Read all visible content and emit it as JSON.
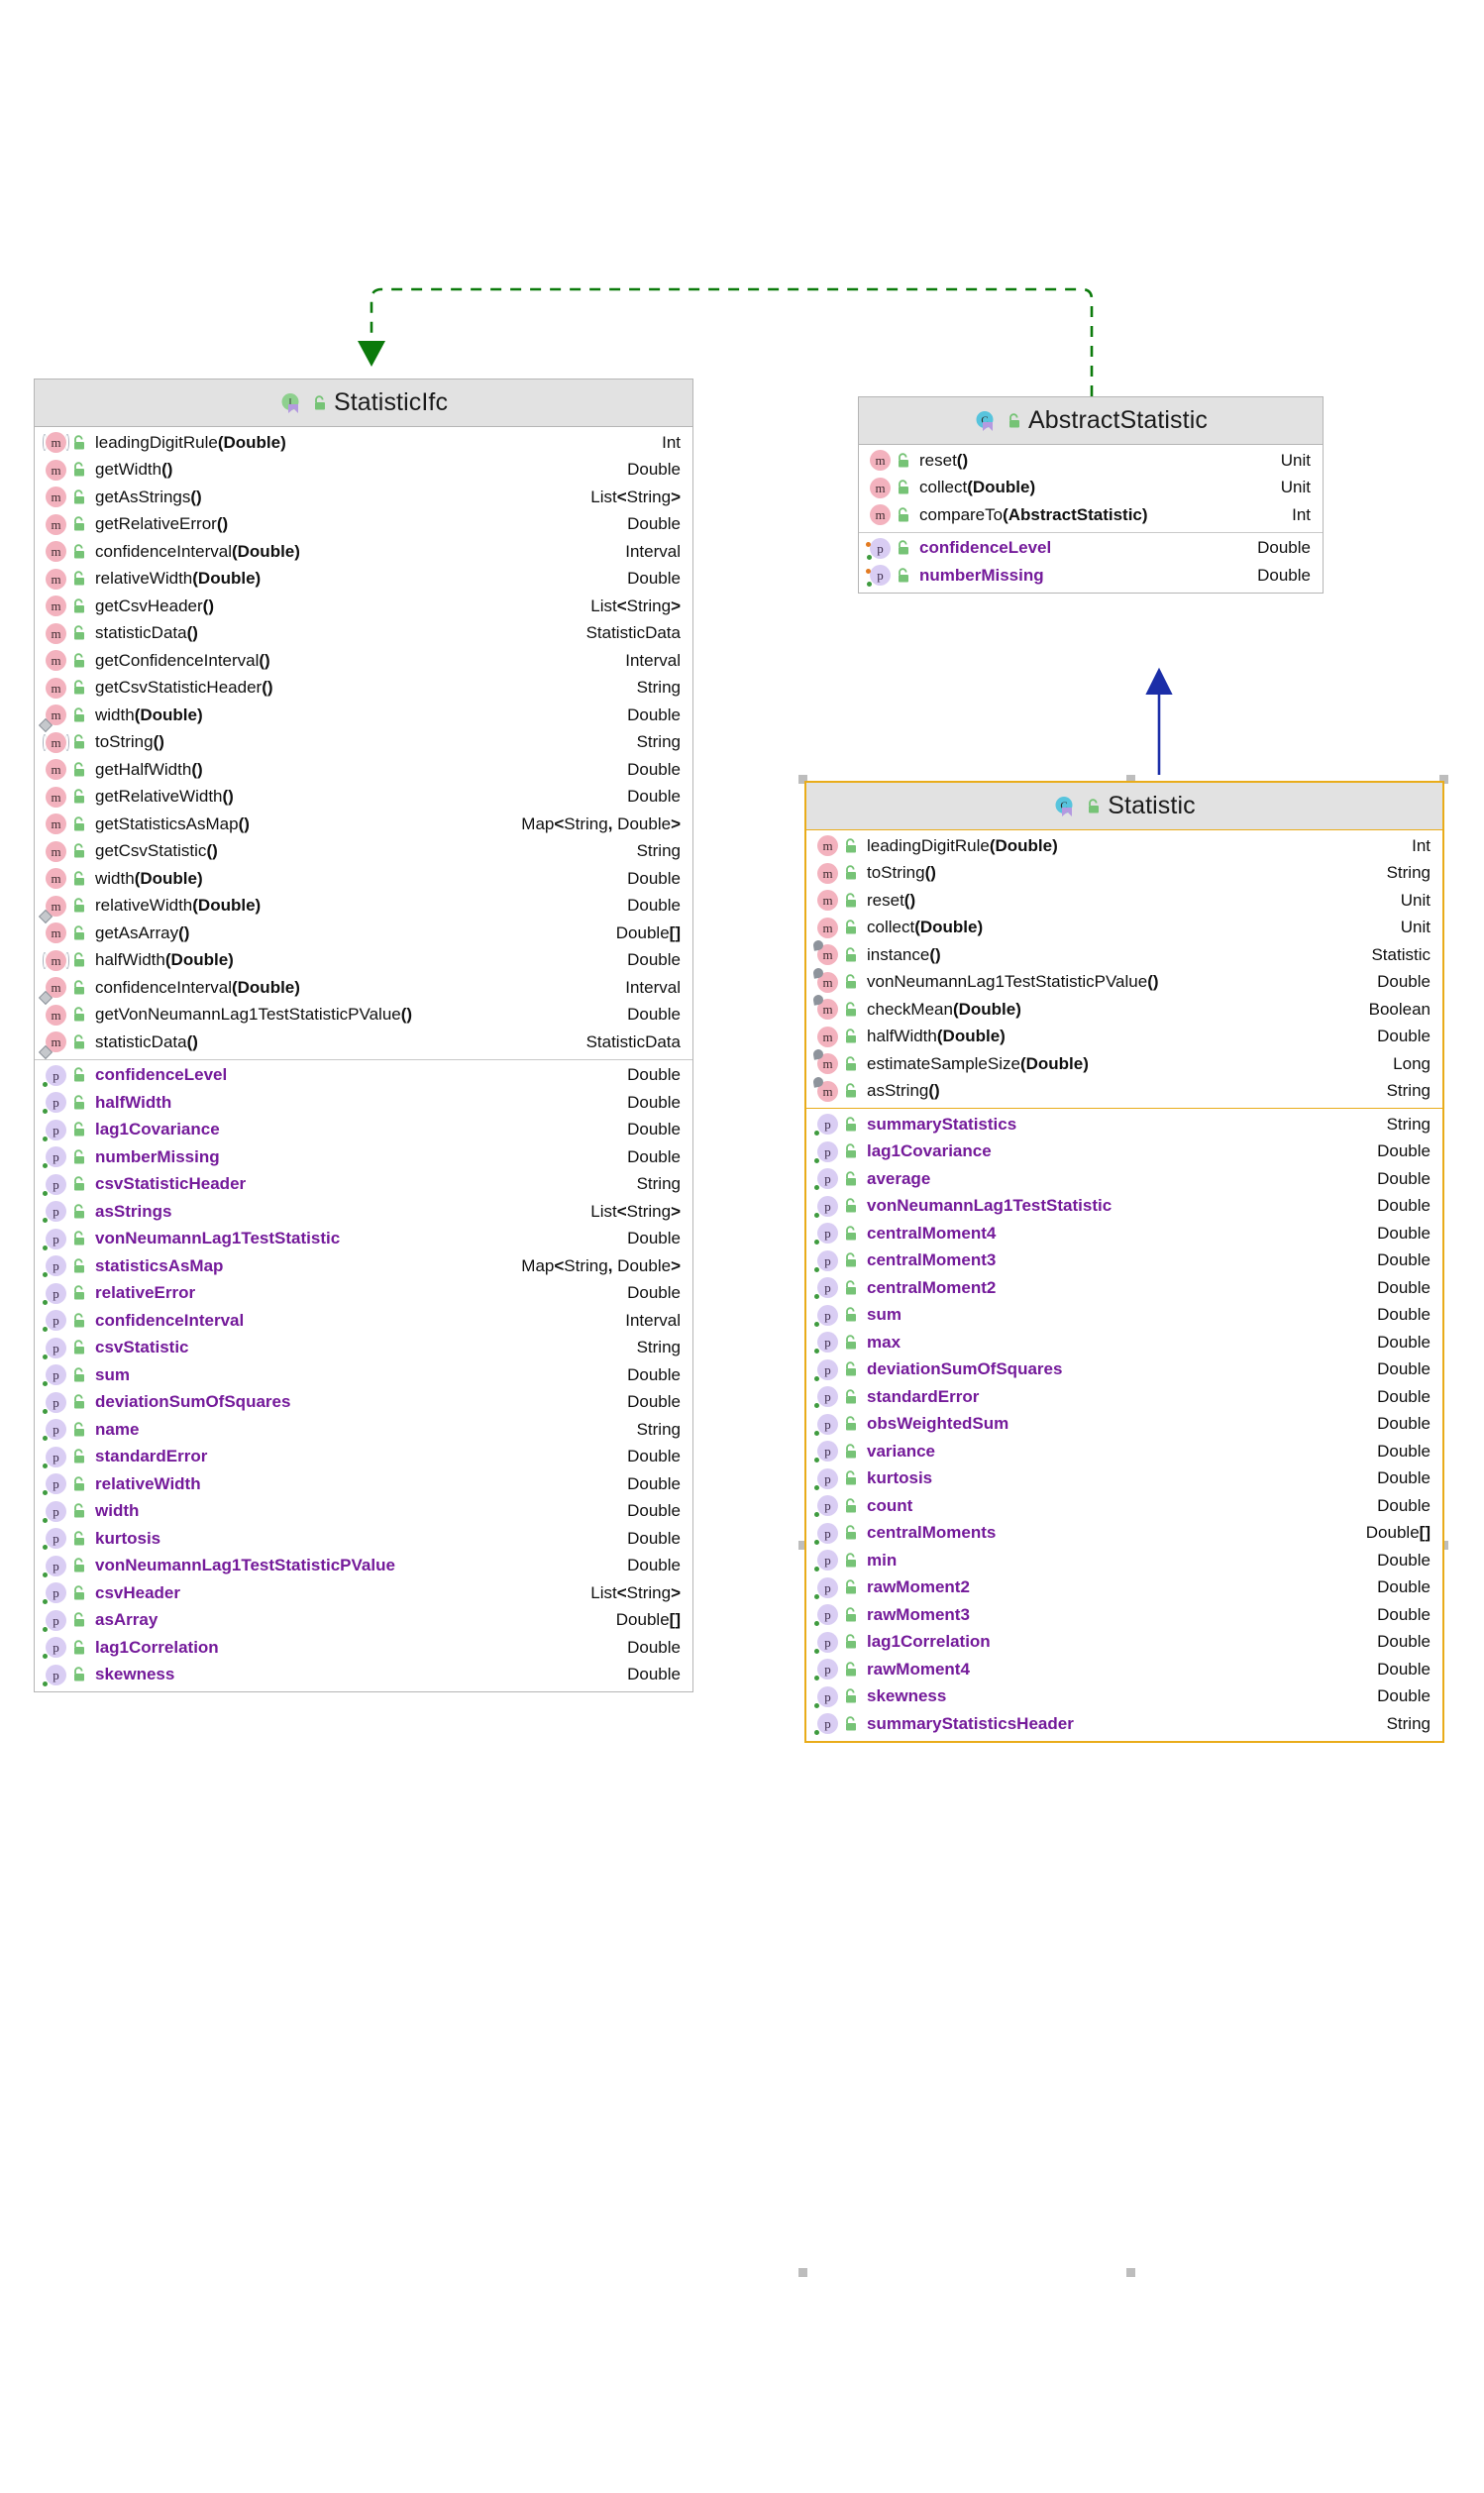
{
  "diagram": {
    "kind": "uml-class-diagram",
    "background": "#ffffff",
    "colors": {
      "header_fill": "#e2e2e2",
      "border": "#b5b5b5",
      "selection_border": "#e9ac1a",
      "property_text": "#741a9a",
      "realization_arrow": "#0b7a0b",
      "generalization_arrow": "#1b2ea8",
      "method_icon": "#f3b2be",
      "property_icon": "#d9cdf3",
      "lock_icon": "#76c376"
    },
    "relations": [
      {
        "name": "statistic-to-abstractstatistic-generalization",
        "from": "Statistic",
        "to": "AbstractStatistic",
        "style": "solid",
        "arrow": "hollow-triangle",
        "color": "#1b2ea8"
      },
      {
        "name": "abstractstatistic-to-statisticifc-realization",
        "from": "AbstractStatistic",
        "to": "StatisticIfc",
        "style": "dashed",
        "arrow": "filled-triangle",
        "color": "#0b7a0b"
      }
    ]
  },
  "classes": [
    {
      "id": "statisticifc",
      "name": "StatisticIfc",
      "stereotype": "interface",
      "type_icon": "interface-icon",
      "visibility_icon": "unlocked-padlock-icon",
      "selected": false,
      "methods": [
        {
          "name": "leadingDigitRule",
          "args": "(Double)",
          "type": "Int",
          "overridden": true
        },
        {
          "name": "getWidth",
          "args": "()",
          "type": "Double"
        },
        {
          "name": "getAsStrings",
          "args": "()",
          "type": "List<String>"
        },
        {
          "name": "getRelativeError",
          "args": "()",
          "type": "Double"
        },
        {
          "name": "confidenceInterval",
          "args": "(Double)",
          "type": "Interval"
        },
        {
          "name": "relativeWidth",
          "args": "(Double)",
          "type": "Double"
        },
        {
          "name": "getCsvHeader",
          "args": "()",
          "type": "List<String>"
        },
        {
          "name": "statisticData",
          "args": "()",
          "type": "StatisticData"
        },
        {
          "name": "getConfidenceInterval",
          "args": "()",
          "type": "Interval"
        },
        {
          "name": "getCsvStatisticHeader",
          "args": "()",
          "type": "String"
        },
        {
          "name": "width",
          "args": "(Double)",
          "type": "Double",
          "marker": "diamond"
        },
        {
          "name": "toString",
          "args": "()",
          "type": "String",
          "overridden": true
        },
        {
          "name": "getHalfWidth",
          "args": "()",
          "type": "Double"
        },
        {
          "name": "getRelativeWidth",
          "args": "()",
          "type": "Double"
        },
        {
          "name": "getStatisticsAsMap",
          "args": "()",
          "type": "Map<String, Double>"
        },
        {
          "name": "getCsvStatistic",
          "args": "()",
          "type": "String"
        },
        {
          "name": "width",
          "args": "(Double)",
          "type": "Double"
        },
        {
          "name": "relativeWidth",
          "args": "(Double)",
          "type": "Double",
          "marker": "diamond"
        },
        {
          "name": "getAsArray",
          "args": "()",
          "type": "Double[]"
        },
        {
          "name": "halfWidth",
          "args": "(Double)",
          "type": "Double",
          "overridden": true
        },
        {
          "name": "confidenceInterval",
          "args": "(Double)",
          "type": "Interval",
          "marker": "diamond"
        },
        {
          "name": "getVonNeumannLag1TestStatisticPValue",
          "args": "()",
          "type": "Double"
        },
        {
          "name": "statisticData",
          "args": "()",
          "type": "StatisticData",
          "marker": "diamond"
        }
      ],
      "properties": [
        {
          "name": "confidenceLevel",
          "type": "Double"
        },
        {
          "name": "halfWidth",
          "type": "Double"
        },
        {
          "name": "lag1Covariance",
          "type": "Double"
        },
        {
          "name": "numberMissing",
          "type": "Double"
        },
        {
          "name": "csvStatisticHeader",
          "type": "String"
        },
        {
          "name": "asStrings",
          "type": "List<String>"
        },
        {
          "name": "vonNeumannLag1TestStatistic",
          "type": "Double"
        },
        {
          "name": "statisticsAsMap",
          "type": "Map<String, Double>"
        },
        {
          "name": "relativeError",
          "type": "Double"
        },
        {
          "name": "confidenceInterval",
          "type": "Interval"
        },
        {
          "name": "csvStatistic",
          "type": "String"
        },
        {
          "name": "sum",
          "type": "Double"
        },
        {
          "name": "deviationSumOfSquares",
          "type": "Double"
        },
        {
          "name": "name",
          "type": "String"
        },
        {
          "name": "standardError",
          "type": "Double"
        },
        {
          "name": "relativeWidth",
          "type": "Double"
        },
        {
          "name": "width",
          "type": "Double"
        },
        {
          "name": "kurtosis",
          "type": "Double"
        },
        {
          "name": "vonNeumannLag1TestStatisticPValue",
          "type": "Double"
        },
        {
          "name": "csvHeader",
          "type": "List<String>"
        },
        {
          "name": "asArray",
          "type": "Double[]"
        },
        {
          "name": "lag1Correlation",
          "type": "Double"
        },
        {
          "name": "skewness",
          "type": "Double"
        }
      ]
    },
    {
      "id": "abstractstatistic",
      "name": "AbstractStatistic",
      "stereotype": "abstract class",
      "type_icon": "abstract-class-icon",
      "visibility_icon": "unlocked-padlock-icon",
      "selected": false,
      "methods": [
        {
          "name": "reset",
          "args": "()",
          "type": "Unit"
        },
        {
          "name": "collect",
          "args": "(Double)",
          "type": "Unit"
        },
        {
          "name": "compareTo",
          "args": "(AbstractStatistic)",
          "type": "Int"
        }
      ],
      "properties": [
        {
          "name": "confidenceLevel",
          "type": "Double",
          "mutable": true
        },
        {
          "name": "numberMissing",
          "type": "Double",
          "mutable": true
        }
      ]
    },
    {
      "id": "statistic",
      "name": "Statistic",
      "stereotype": "class",
      "type_icon": "class-icon",
      "visibility_icon": "unlocked-padlock-icon",
      "selected": true,
      "methods": [
        {
          "name": "leadingDigitRule",
          "args": "(Double)",
          "type": "Int"
        },
        {
          "name": "toString",
          "args": "()",
          "type": "String"
        },
        {
          "name": "reset",
          "args": "()",
          "type": "Unit"
        },
        {
          "name": "collect",
          "args": "(Double)",
          "type": "Unit"
        },
        {
          "name": "instance",
          "args": "()",
          "type": "Statistic",
          "static": true
        },
        {
          "name": "vonNeumannLag1TestStatisticPValue",
          "args": "()",
          "type": "Double",
          "static": true
        },
        {
          "name": "checkMean",
          "args": "(Double)",
          "type": "Boolean",
          "static": true
        },
        {
          "name": "halfWidth",
          "args": "(Double)",
          "type": "Double"
        },
        {
          "name": "estimateSampleSize",
          "args": "(Double)",
          "type": "Long",
          "static": true
        },
        {
          "name": "asString",
          "args": "()",
          "type": "String",
          "static": true
        }
      ],
      "properties": [
        {
          "name": "summaryStatistics",
          "type": "String"
        },
        {
          "name": "lag1Covariance",
          "type": "Double"
        },
        {
          "name": "average",
          "type": "Double"
        },
        {
          "name": "vonNeumannLag1TestStatistic",
          "type": "Double"
        },
        {
          "name": "centralMoment4",
          "type": "Double"
        },
        {
          "name": "centralMoment3",
          "type": "Double"
        },
        {
          "name": "centralMoment2",
          "type": "Double"
        },
        {
          "name": "sum",
          "type": "Double"
        },
        {
          "name": "max",
          "type": "Double"
        },
        {
          "name": "deviationSumOfSquares",
          "type": "Double"
        },
        {
          "name": "standardError",
          "type": "Double"
        },
        {
          "name": "obsWeightedSum",
          "type": "Double"
        },
        {
          "name": "variance",
          "type": "Double"
        },
        {
          "name": "kurtosis",
          "type": "Double"
        },
        {
          "name": "count",
          "type": "Double"
        },
        {
          "name": "centralMoments",
          "type": "Double[]"
        },
        {
          "name": "min",
          "type": "Double"
        },
        {
          "name": "rawMoment2",
          "type": "Double"
        },
        {
          "name": "rawMoment3",
          "type": "Double"
        },
        {
          "name": "lag1Correlation",
          "type": "Double"
        },
        {
          "name": "rawMoment4",
          "type": "Double"
        },
        {
          "name": "skewness",
          "type": "Double"
        },
        {
          "name": "summaryStatisticsHeader",
          "type": "String"
        }
      ]
    }
  ]
}
